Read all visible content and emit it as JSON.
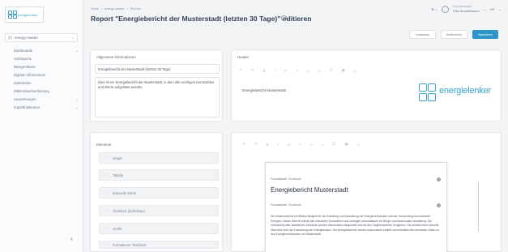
{
  "sidebar": {
    "logo_text": "energielenker",
    "selector": "energy-master",
    "items": [
      {
        "label": "Dashboards",
        "has_children": true
      },
      {
        "label": "Verbräuche",
        "has_children": false
      },
      {
        "label": "Mengenflüsse",
        "has_children": false
      },
      {
        "label": "Digitale Infomonitore",
        "has_children": false
      },
      {
        "label": "Datenlisten",
        "has_children": false
      },
      {
        "label": "Zählerstandserfassung",
        "has_children": false
      },
      {
        "label": "Auswertungen",
        "has_children": true
      },
      {
        "label": "Importfunktionen",
        "has_children": true
      }
    ]
  },
  "header": {
    "breadcrumb": [
      "Home",
      "/",
      "energy-master",
      "/",
      "Reports"
    ],
    "title": "Report \"Energiebericht der Musterstadt (letzten 30 Tage)\" editieren",
    "user_name": "Elke Musterfrauen",
    "user_role": "Energiemanager",
    "lang": "DE",
    "actions": {
      "preview": "Vorschau",
      "cancel": "Abbrechen",
      "save": "Speichern"
    }
  },
  "general": {
    "title": "Allgemeine Informationen",
    "name_value": "Energiebericht der Musterstadt (letzten 30 Tage)",
    "description_value": "Dies ist ein Energiebericht der Musterstadt, in dem alle wichtigen Kennzahlen und Werte aufgelistet werden."
  },
  "header_card": {
    "title": "Header",
    "content": "Energiebericht Musterstadt",
    "brand_main": "energielenker",
    "brand_sub": "..."
  },
  "elements": {
    "title": "Elemente",
    "items": [
      "Graph",
      "Tabelle",
      "Manuelle Werte",
      "Textblock (Zeilenbau)",
      "Grafik",
      "Formatierter Textblock"
    ]
  },
  "preview": {
    "block1_label": "Formatierter Textblock",
    "heading": "Energiebericht Musterstadt",
    "block2_label": "Formatierter Textblock",
    "body": "Die Musterstadt ist ein fiktives Beispiel für die Erstellung und Darstellung der Energieverbräuche und der Verwendung erneuerbarer Energien. Dieser Bericht enthält alle relevanten Kennzahlen und wichtigen Informationen für Bürger und kommunale Verwaltung. Die Verbräuche aller städtischen Gebäude werden übersichtlich dargestellt und mit den Vorjahreswerten verglichen. Sie erhalten eine schnelle Übersicht über die Entwicklung der Energiekosten. Die Energieberichte werden automatisch erstellt und enthalten alle relevanten Daten zu den Energieverbräuchen der Musterstadt."
  }
}
